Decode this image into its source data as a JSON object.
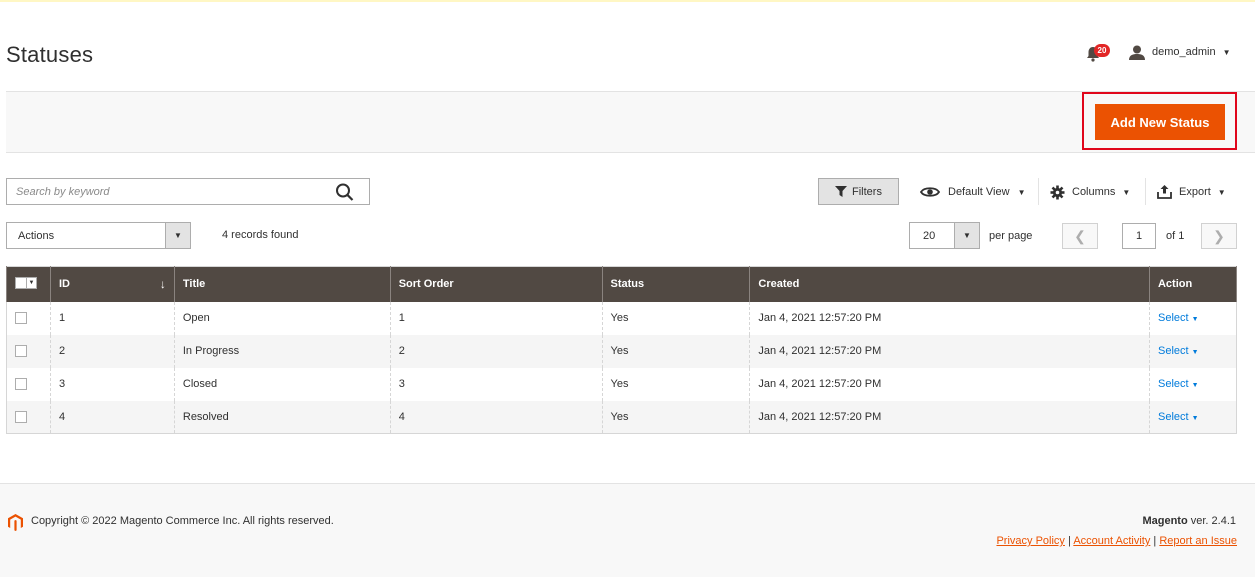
{
  "page": {
    "title": "Statuses"
  },
  "header": {
    "notifications_count": "20",
    "username": "demo_admin"
  },
  "actions": {
    "add_new": "Add New Status"
  },
  "toolbar": {
    "search_placeholder": "Search by keyword",
    "filters_label": "Filters",
    "view_label": "Default View",
    "columns_label": "Columns",
    "export_label": "Export",
    "mass_actions_label": "Actions",
    "records_found": "4 records found",
    "per_page_value": "20",
    "per_page_label": "per page",
    "page_current": "1",
    "page_of": "of 1"
  },
  "grid": {
    "columns": [
      "ID",
      "Title",
      "Sort Order",
      "Status",
      "Created",
      "Action"
    ],
    "rows": [
      {
        "id": "1",
        "title": "Open",
        "sort_order": "1",
        "status": "Yes",
        "created": "Jan 4, 2021 12:57:20 PM",
        "action": "Select"
      },
      {
        "id": "2",
        "title": "In Progress",
        "sort_order": "2",
        "status": "Yes",
        "created": "Jan 4, 2021 12:57:20 PM",
        "action": "Select"
      },
      {
        "id": "3",
        "title": "Closed",
        "sort_order": "3",
        "status": "Yes",
        "created": "Jan 4, 2021 12:57:20 PM",
        "action": "Select"
      },
      {
        "id": "4",
        "title": "Resolved",
        "sort_order": "4",
        "status": "Yes",
        "created": "Jan 4, 2021 12:57:20 PM",
        "action": "Select"
      }
    ]
  },
  "footer": {
    "copyright": "Copyright © 2022 Magento Commerce Inc. All rights reserved.",
    "brand": "Magento",
    "version": " ver. 2.4.1",
    "privacy": "Privacy Policy",
    "account_activity": " Account Activity",
    "report_issue": "Report an Issue",
    "separator": " | "
  },
  "colors": {
    "accent": "#eb5202",
    "grid_header": "#514943",
    "link": "#007bdb",
    "highlight": "#e0061b"
  }
}
